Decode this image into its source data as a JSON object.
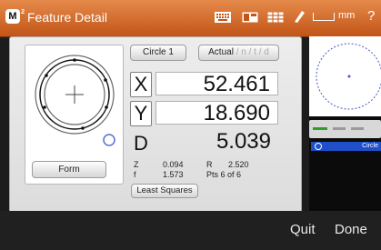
{
  "titlebar": {
    "logo": "M",
    "logo_sup": "2",
    "title": "Feature Detail",
    "unit": "mm",
    "help": "?"
  },
  "dialog": {
    "feature_button": "Circle 1",
    "mode_button_active": "Actual",
    "mode_button_rest": " / n / t / d",
    "form_button": "Form",
    "axes": [
      {
        "label": "X",
        "value": "52.461"
      },
      {
        "label": "Y",
        "value": "18.690"
      }
    ],
    "diameter": {
      "label": "D",
      "value": "5.039"
    },
    "stats": {
      "z_label": "Z",
      "z_value": "0.094",
      "r_label": "R",
      "r_value": "2.520",
      "f_label": "f",
      "f_value": "1.573",
      "pts": "Pts 6 of 6"
    },
    "fit_button": "Least Squares"
  },
  "right_panel": {
    "row_label": "Circle"
  },
  "bottombar": {
    "quit": "Quit",
    "done": "Done"
  },
  "colors": {
    "titlebar": "#d16a2a",
    "selection": "#1f4fc9",
    "fit_circle": "#5a6bd8"
  }
}
